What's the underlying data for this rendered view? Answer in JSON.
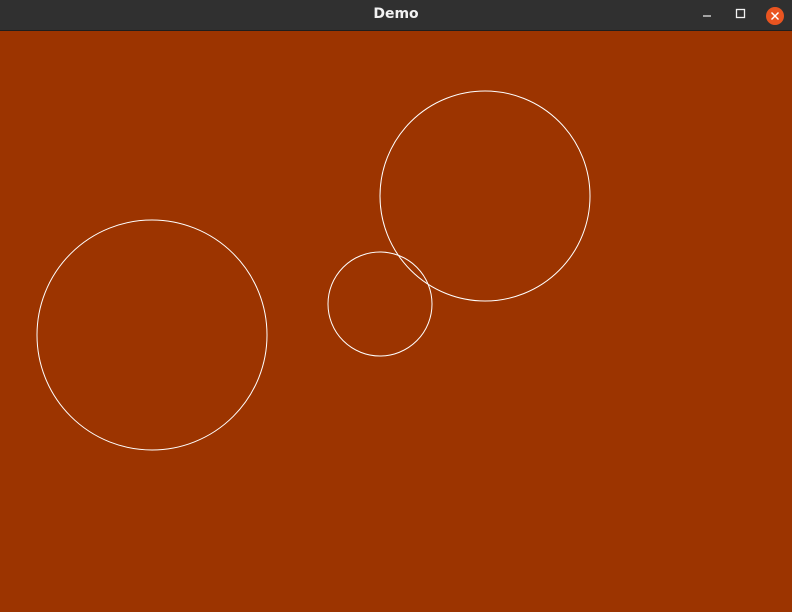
{
  "window": {
    "title": "Demo",
    "controls": {
      "minimize_icon": "minimize-icon",
      "maximize_icon": "maximize-icon",
      "close_icon": "close-icon"
    }
  },
  "canvas": {
    "background": "#9c3400",
    "stroke_color": "#ffffff",
    "shapes": [
      {
        "type": "circle",
        "label": "left-circle"
      },
      {
        "type": "circle",
        "label": "middle-small-circle"
      },
      {
        "type": "circle",
        "label": "upper-right-circle"
      }
    ]
  },
  "colors": {
    "titlebar": "#303030",
    "title_text": "#f2f2f2",
    "close_accent": "#e95420"
  }
}
